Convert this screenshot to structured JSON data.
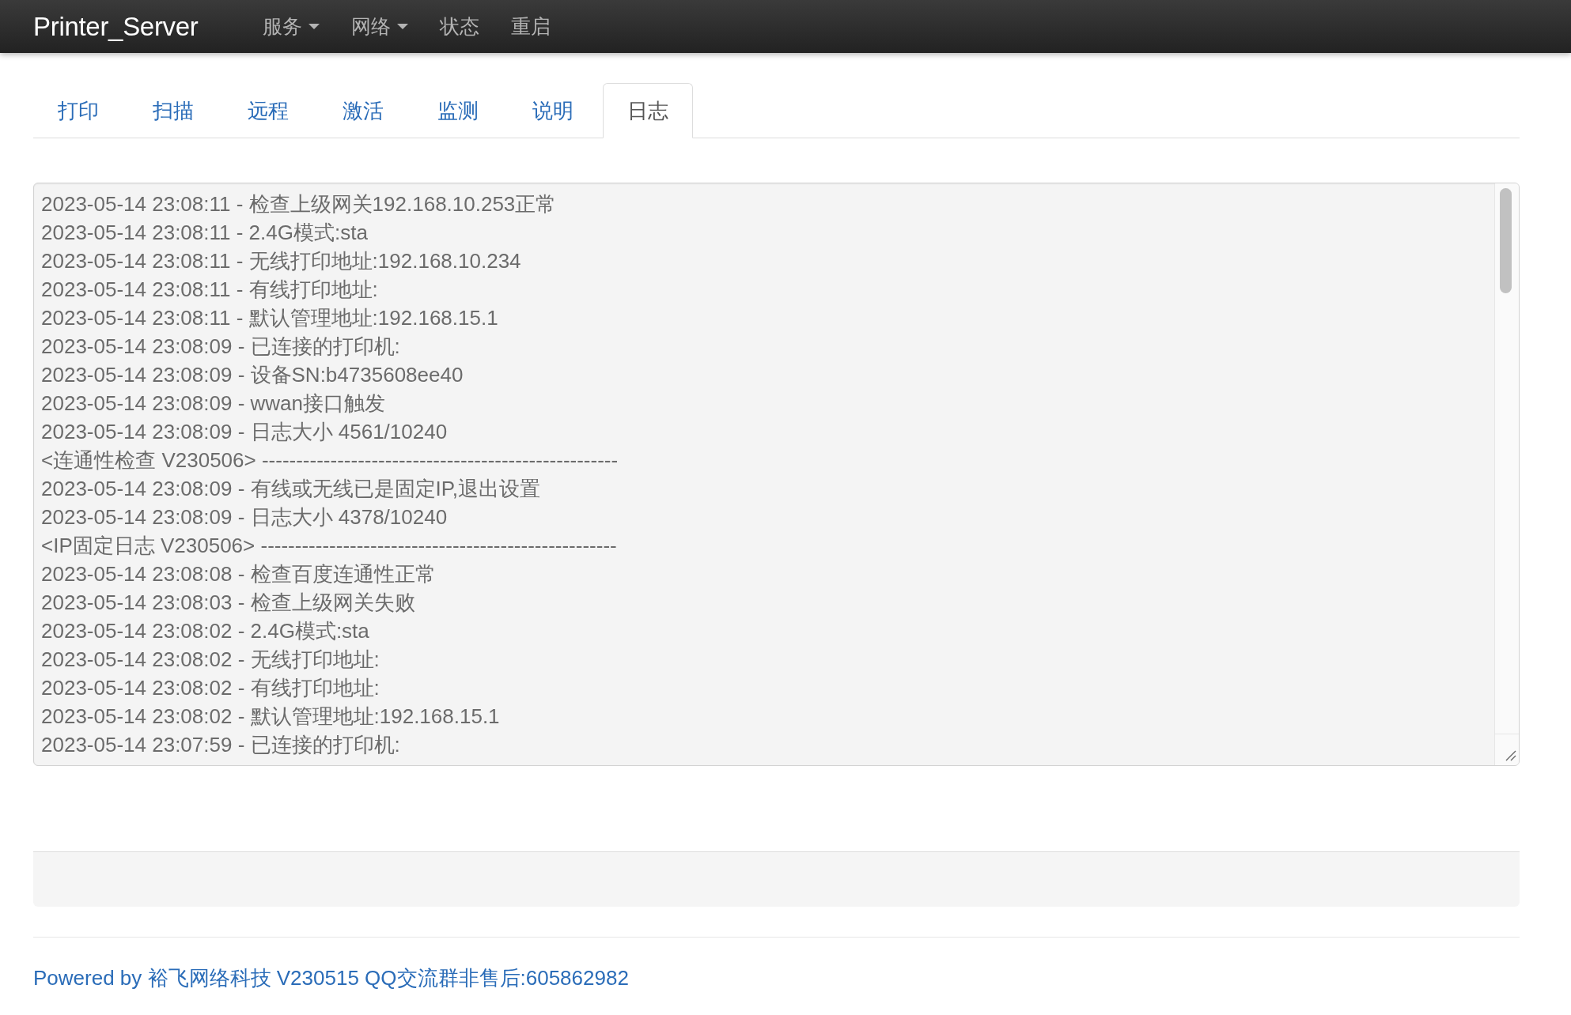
{
  "navbar": {
    "brand": "Printer_Server",
    "items": [
      {
        "label": "服务",
        "dropdown": true
      },
      {
        "label": "网络",
        "dropdown": true
      },
      {
        "label": "状态",
        "dropdown": false
      },
      {
        "label": "重启",
        "dropdown": false
      }
    ]
  },
  "tabs": [
    {
      "label": "打印",
      "selected": false
    },
    {
      "label": "扫描",
      "selected": false
    },
    {
      "label": "远程",
      "selected": false
    },
    {
      "label": "激活",
      "selected": false
    },
    {
      "label": "监测",
      "selected": false
    },
    {
      "label": "说明",
      "selected": false
    },
    {
      "label": "日志",
      "selected": true
    }
  ],
  "log": {
    "lines": [
      "2023-05-14 23:08:11 - 检查上级网关192.168.10.253正常",
      "2023-05-14 23:08:11 - 2.4G模式:sta",
      "2023-05-14 23:08:11 - 无线打印地址:192.168.10.234",
      "2023-05-14 23:08:11 - 有线打印地址:",
      "2023-05-14 23:08:11 - 默认管理地址:192.168.15.1",
      "2023-05-14 23:08:09 - 已连接的打印机:",
      "2023-05-14 23:08:09 - 设备SN:b4735608ee40",
      "2023-05-14 23:08:09 - wwan接口触发",
      "2023-05-14 23:08:09 - 日志大小 4561/10240",
      "<连通性检查 V230506> ----------------------------------------------------",
      "2023-05-14 23:08:09 - 有线或无线已是固定IP,退出设置",
      "2023-05-14 23:08:09 - 日志大小 4378/10240",
      "<IP固定日志 V230506> ----------------------------------------------------",
      "2023-05-14 23:08:08 - 检查百度连通性正常",
      "2023-05-14 23:08:03 - 检查上级网关失败",
      "2023-05-14 23:08:02 - 2.4G模式:sta",
      "2023-05-14 23:08:02 - 无线打印地址:",
      "2023-05-14 23:08:02 - 有线打印地址:",
      "2023-05-14 23:08:02 - 默认管理地址:192.168.15.1",
      "2023-05-14 23:07:59 - 已连接的打印机:"
    ]
  },
  "footer": {
    "text": "Powered by 裕飞网络科技 V230515 QQ交流群非售后:605862982"
  }
}
